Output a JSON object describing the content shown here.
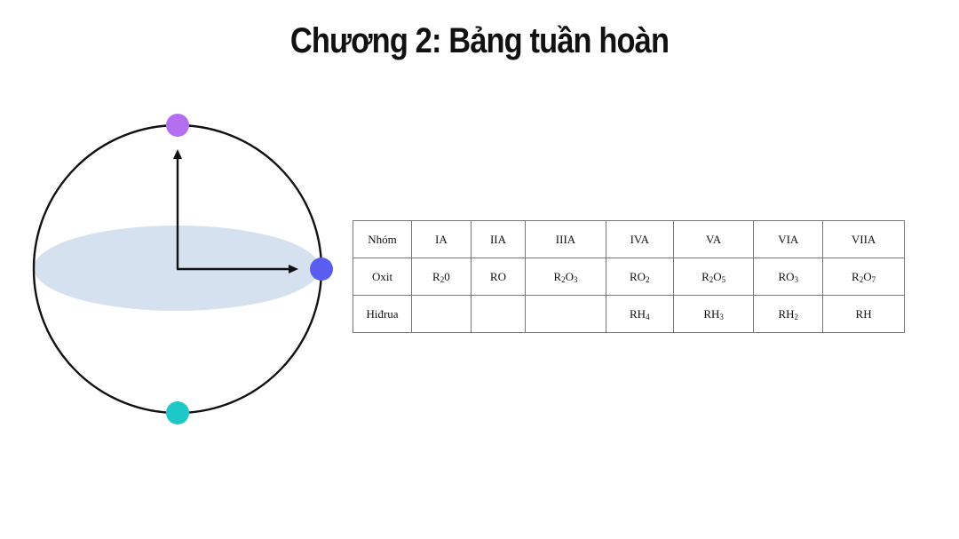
{
  "title": "Chương 2: Bảng tuần hoàn",
  "diagram": {
    "colors": {
      "top_dot": "#b46ef0",
      "right_dot": "#5a5ef0",
      "bottom_dot": "#1fc8c8",
      "equator_fill": "#d6e1ef",
      "circle_stroke": "#111111",
      "arrow_stroke": "#111111"
    }
  },
  "table": {
    "rows": [
      {
        "header": "Nhóm",
        "cells": [
          "IA",
          "IIA",
          "IIIA",
          "IVA",
          "VA",
          "VIA",
          "VIIA"
        ]
      },
      {
        "header": "Oxit",
        "cells": [
          "R₂0",
          "RO",
          "R₂O₃",
          "RO₂",
          "R₂O₅",
          "RO₃",
          "R₂O₇"
        ]
      },
      {
        "header": "Hiđrua",
        "cells": [
          "",
          "",
          "",
          "RH₄",
          "RH₃",
          "RH₂",
          "RH"
        ]
      }
    ]
  }
}
